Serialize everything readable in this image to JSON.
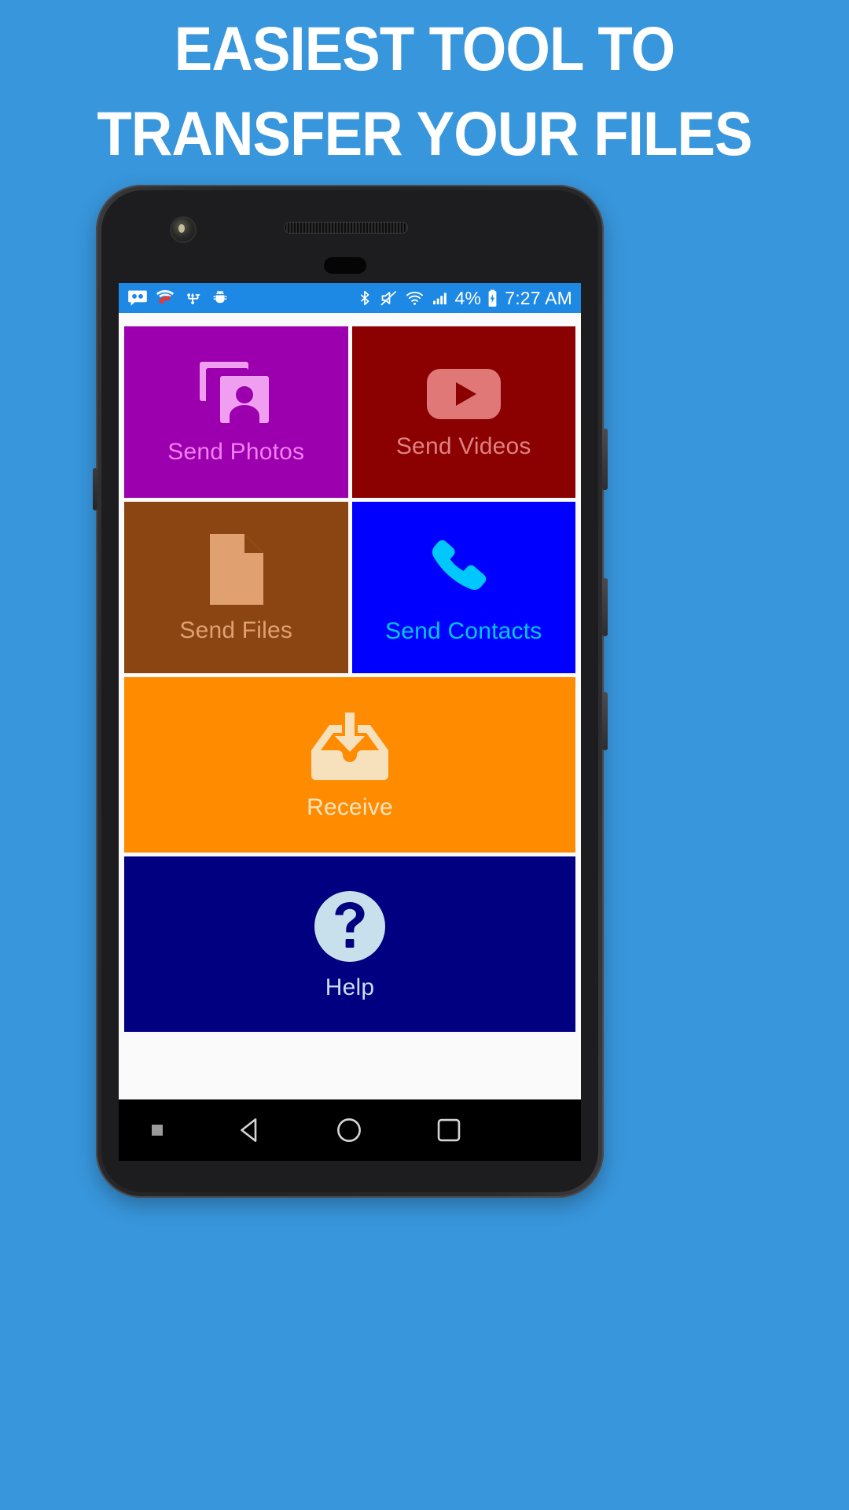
{
  "promo": {
    "background_color": "#3896DC",
    "headline_line1": "EASIEST TOOL TO",
    "headline_line2": "TRANSFER YOUR FILES",
    "headline_color": "#FFFFFF"
  },
  "status_bar": {
    "background_color": "#1E88E5",
    "text_color": "#FFFFFF",
    "left_icons": [
      {
        "name": "voicemail-icon",
        "label": "Voicemail"
      },
      {
        "name": "wifi-calling-icon",
        "label": "Wi-Fi calling"
      },
      {
        "name": "usb-icon",
        "label": "USB connected"
      },
      {
        "name": "android-debug-icon",
        "label": "USB debugging"
      }
    ],
    "right_icons": [
      {
        "name": "bluetooth-icon",
        "label": "Bluetooth"
      },
      {
        "name": "volume-mute-icon",
        "label": "Muted"
      },
      {
        "name": "wifi-icon",
        "label": "Wi-Fi"
      },
      {
        "name": "cell-signal-icon",
        "label": "Cellular signal"
      }
    ],
    "battery_percent": "4%",
    "battery_icon": "battery-charging-icon",
    "clock": "7:27 AM"
  },
  "tiles": [
    {
      "id": "send-photos",
      "label": "Send Photos",
      "icon": "photo-library-icon",
      "background": "#9C00AE",
      "label_color": "#F07FF0",
      "icon_color": "#F09FF0"
    },
    {
      "id": "send-videos",
      "label": "Send Videos",
      "icon": "video-play-icon",
      "background": "#8B0000",
      "label_color": "#E08080",
      "icon_color": "#E07878"
    },
    {
      "id": "send-files",
      "label": "Send Files",
      "icon": "document-icon",
      "background": "#8B4513",
      "label_color": "#E0A070",
      "icon_color": "#E0A070"
    },
    {
      "id": "send-contacts",
      "label": "Send Contacts",
      "icon": "phone-handset-icon",
      "background": "#0000FF",
      "label_color": "#00C8FF",
      "icon_color": "#00C8FF"
    },
    {
      "id": "receive",
      "label": "Receive",
      "icon": "inbox-download-icon",
      "background": "#FF8C00",
      "label_color": "#FAE3C0",
      "icon_color": "#F7E0BC"
    },
    {
      "id": "help",
      "label": "Help",
      "icon": "question-circle-icon",
      "background": "#000080",
      "label_color": "#C8DCEC",
      "icon_color": "#C8E0EC"
    }
  ],
  "nav_bar": {
    "background_color": "#000000",
    "items": [
      {
        "name": "nav-indicator-dot",
        "label": "Indicator"
      },
      {
        "name": "nav-back-icon",
        "label": "Back"
      },
      {
        "name": "nav-home-icon",
        "label": "Home"
      },
      {
        "name": "nav-recents-icon",
        "label": "Recent apps"
      }
    ]
  }
}
